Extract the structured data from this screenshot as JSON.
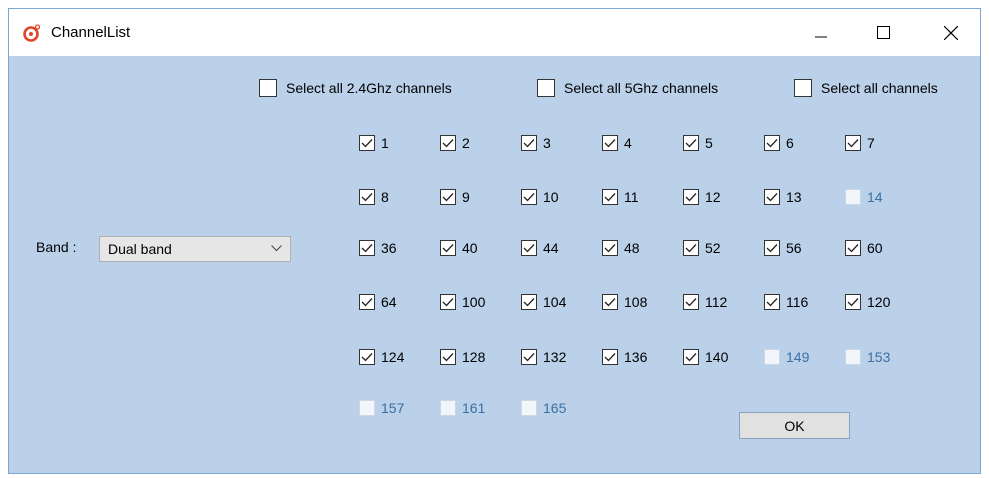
{
  "window": {
    "title": "ChannelList"
  },
  "select_all": {
    "g24": "Select all 2.4Ghz channels",
    "g5": "Select all 5Ghz channels",
    "all": "Select all channels"
  },
  "band": {
    "label": "Band :",
    "value": "Dual band"
  },
  "ok_label": "OK",
  "channels": [
    {
      "label": "1",
      "checked": true
    },
    {
      "label": "2",
      "checked": true
    },
    {
      "label": "3",
      "checked": true
    },
    {
      "label": "4",
      "checked": true
    },
    {
      "label": "5",
      "checked": true
    },
    {
      "label": "6",
      "checked": true
    },
    {
      "label": "7",
      "checked": true
    },
    {
      "label": "8",
      "checked": true
    },
    {
      "label": "9",
      "checked": true
    },
    {
      "label": "10",
      "checked": true
    },
    {
      "label": "11",
      "checked": true
    },
    {
      "label": "12",
      "checked": true
    },
    {
      "label": "13",
      "checked": true
    },
    {
      "label": "14",
      "checked": false
    },
    {
      "label": "36",
      "checked": true
    },
    {
      "label": "40",
      "checked": true
    },
    {
      "label": "44",
      "checked": true
    },
    {
      "label": "48",
      "checked": true
    },
    {
      "label": "52",
      "checked": true
    },
    {
      "label": "56",
      "checked": true
    },
    {
      "label": "60",
      "checked": true
    },
    {
      "label": "64",
      "checked": true
    },
    {
      "label": "100",
      "checked": true
    },
    {
      "label": "104",
      "checked": true
    },
    {
      "label": "108",
      "checked": true
    },
    {
      "label": "112",
      "checked": true
    },
    {
      "label": "116",
      "checked": true
    },
    {
      "label": "120",
      "checked": true
    },
    {
      "label": "124",
      "checked": true
    },
    {
      "label": "128",
      "checked": true
    },
    {
      "label": "132",
      "checked": true
    },
    {
      "label": "136",
      "checked": true
    },
    {
      "label": "140",
      "checked": true
    },
    {
      "label": "149",
      "checked": false
    },
    {
      "label": "153",
      "checked": false
    },
    {
      "label": "157",
      "checked": false
    },
    {
      "label": "161",
      "checked": false
    },
    {
      "label": "165",
      "checked": false
    }
  ]
}
